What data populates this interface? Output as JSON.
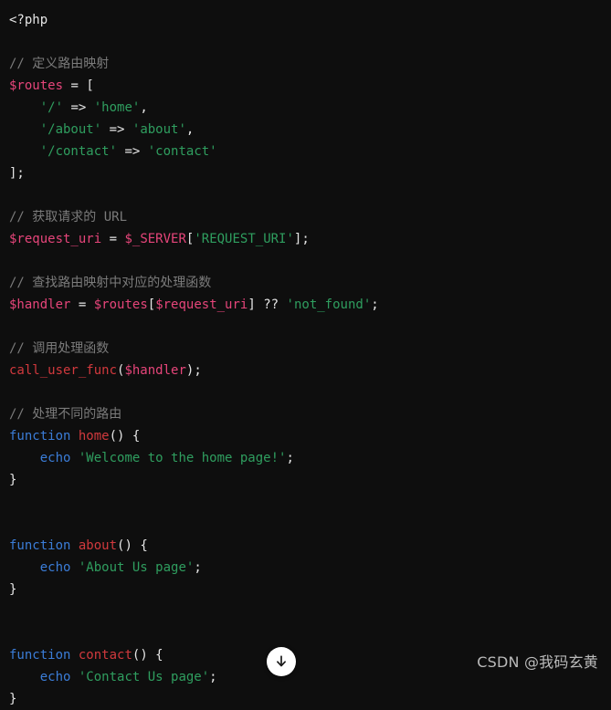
{
  "editor": {
    "language": "php",
    "background_color": "#0e0e0e",
    "font_size_px": 14,
    "line_height_px": 24
  },
  "theme": {
    "plain": "#e6e6e6",
    "comment": "#7b7b7b",
    "variable": "#e6457a",
    "string": "#2f9e5f",
    "keyword": "#3b7dd8",
    "function": "#d1393d",
    "punctuation": "#e6e6e6"
  },
  "code": {
    "lines": [
      {
        "id": "l1",
        "tokens": [
          {
            "t": "<?php",
            "c": "plain"
          }
        ]
      },
      {
        "id": "l2",
        "tokens": []
      },
      {
        "id": "l3",
        "tokens": [
          {
            "t": "// 定义路由映射",
            "c": "comment"
          }
        ]
      },
      {
        "id": "l4",
        "tokens": [
          {
            "t": "$routes",
            "c": "variable"
          },
          {
            "t": " ",
            "c": "plain"
          },
          {
            "t": "=",
            "c": "punctuation"
          },
          {
            "t": " ",
            "c": "plain"
          },
          {
            "t": "[",
            "c": "punctuation"
          }
        ]
      },
      {
        "id": "l5",
        "tokens": [
          {
            "t": "    ",
            "c": "plain"
          },
          {
            "t": "'/'",
            "c": "string"
          },
          {
            "t": " ",
            "c": "plain"
          },
          {
            "t": "=>",
            "c": "punctuation"
          },
          {
            "t": " ",
            "c": "plain"
          },
          {
            "t": "'home'",
            "c": "string"
          },
          {
            "t": ",",
            "c": "punctuation"
          }
        ]
      },
      {
        "id": "l6",
        "tokens": [
          {
            "t": "    ",
            "c": "plain"
          },
          {
            "t": "'/about'",
            "c": "string"
          },
          {
            "t": " ",
            "c": "plain"
          },
          {
            "t": "=>",
            "c": "punctuation"
          },
          {
            "t": " ",
            "c": "plain"
          },
          {
            "t": "'about'",
            "c": "string"
          },
          {
            "t": ",",
            "c": "punctuation"
          }
        ]
      },
      {
        "id": "l7",
        "tokens": [
          {
            "t": "    ",
            "c": "plain"
          },
          {
            "t": "'/contact'",
            "c": "string"
          },
          {
            "t": " ",
            "c": "plain"
          },
          {
            "t": "=>",
            "c": "punctuation"
          },
          {
            "t": " ",
            "c": "plain"
          },
          {
            "t": "'contact'",
            "c": "string"
          }
        ]
      },
      {
        "id": "l8",
        "tokens": [
          {
            "t": "];",
            "c": "punctuation"
          }
        ]
      },
      {
        "id": "l9",
        "tokens": []
      },
      {
        "id": "l10",
        "tokens": [
          {
            "t": "// 获取请求的 URL",
            "c": "comment"
          }
        ]
      },
      {
        "id": "l11",
        "tokens": [
          {
            "t": "$request_uri",
            "c": "variable"
          },
          {
            "t": " ",
            "c": "plain"
          },
          {
            "t": "=",
            "c": "punctuation"
          },
          {
            "t": " ",
            "c": "plain"
          },
          {
            "t": "$_SERVER",
            "c": "variable"
          },
          {
            "t": "[",
            "c": "punctuation"
          },
          {
            "t": "'REQUEST_URI'",
            "c": "string"
          },
          {
            "t": "];",
            "c": "punctuation"
          }
        ]
      },
      {
        "id": "l12",
        "tokens": []
      },
      {
        "id": "l13",
        "tokens": [
          {
            "t": "// 查找路由映射中对应的处理函数",
            "c": "comment"
          }
        ]
      },
      {
        "id": "l14",
        "tokens": [
          {
            "t": "$handler",
            "c": "variable"
          },
          {
            "t": " ",
            "c": "plain"
          },
          {
            "t": "=",
            "c": "punctuation"
          },
          {
            "t": " ",
            "c": "plain"
          },
          {
            "t": "$routes",
            "c": "variable"
          },
          {
            "t": "[",
            "c": "punctuation"
          },
          {
            "t": "$request_uri",
            "c": "variable"
          },
          {
            "t": "]",
            "c": "punctuation"
          },
          {
            "t": " ",
            "c": "plain"
          },
          {
            "t": "??",
            "c": "punctuation"
          },
          {
            "t": " ",
            "c": "plain"
          },
          {
            "t": "'not_found'",
            "c": "string"
          },
          {
            "t": ";",
            "c": "punctuation"
          }
        ]
      },
      {
        "id": "l15",
        "tokens": []
      },
      {
        "id": "l16",
        "tokens": [
          {
            "t": "// 调用处理函数",
            "c": "comment"
          }
        ]
      },
      {
        "id": "l17",
        "tokens": [
          {
            "t": "call_user_func",
            "c": "function"
          },
          {
            "t": "(",
            "c": "punctuation"
          },
          {
            "t": "$handler",
            "c": "variable"
          },
          {
            "t": ");",
            "c": "punctuation"
          }
        ]
      },
      {
        "id": "l18",
        "tokens": []
      },
      {
        "id": "l19",
        "tokens": [
          {
            "t": "// 处理不同的路由",
            "c": "comment"
          }
        ]
      },
      {
        "id": "l20",
        "tokens": [
          {
            "t": "function",
            "c": "keyword"
          },
          {
            "t": " ",
            "c": "plain"
          },
          {
            "t": "home",
            "c": "function"
          },
          {
            "t": "() {",
            "c": "punctuation"
          }
        ]
      },
      {
        "id": "l21",
        "tokens": [
          {
            "t": "    ",
            "c": "plain"
          },
          {
            "t": "echo",
            "c": "keyword"
          },
          {
            "t": " ",
            "c": "plain"
          },
          {
            "t": "'Welcome to the home page!'",
            "c": "string"
          },
          {
            "t": ";",
            "c": "punctuation"
          }
        ]
      },
      {
        "id": "l22",
        "tokens": [
          {
            "t": "}",
            "c": "punctuation"
          }
        ]
      },
      {
        "id": "l23",
        "tokens": []
      },
      {
        "id": "l24",
        "tokens": []
      },
      {
        "id": "l25",
        "tokens": [
          {
            "t": "function",
            "c": "keyword"
          },
          {
            "t": " ",
            "c": "plain"
          },
          {
            "t": "about",
            "c": "function"
          },
          {
            "t": "() {",
            "c": "punctuation"
          }
        ]
      },
      {
        "id": "l26",
        "tokens": [
          {
            "t": "    ",
            "c": "plain"
          },
          {
            "t": "echo",
            "c": "keyword"
          },
          {
            "t": " ",
            "c": "plain"
          },
          {
            "t": "'About Us page'",
            "c": "string"
          },
          {
            "t": ";",
            "c": "punctuation"
          }
        ]
      },
      {
        "id": "l27",
        "tokens": [
          {
            "t": "}",
            "c": "punctuation"
          }
        ]
      },
      {
        "id": "l28",
        "tokens": []
      },
      {
        "id": "l29",
        "tokens": []
      },
      {
        "id": "l30",
        "tokens": [
          {
            "t": "function",
            "c": "keyword"
          },
          {
            "t": " ",
            "c": "plain"
          },
          {
            "t": "contact",
            "c": "function"
          },
          {
            "t": "() {",
            "c": "punctuation"
          }
        ]
      },
      {
        "id": "l31",
        "tokens": [
          {
            "t": "    ",
            "c": "plain"
          },
          {
            "t": "echo",
            "c": "keyword"
          },
          {
            "t": " ",
            "c": "plain"
          },
          {
            "t": "'Contact Us page'",
            "c": "string"
          },
          {
            "t": ";",
            "c": "punctuation"
          }
        ]
      },
      {
        "id": "l32",
        "tokens": [
          {
            "t": "}",
            "c": "punctuation"
          }
        ]
      }
    ]
  },
  "controls": {
    "scroll_down": {
      "icon": "arrow-down-icon",
      "label": "",
      "background_color": "#ffffff",
      "icon_color": "#1a1a1a"
    }
  },
  "watermark": {
    "text": "CSDN @我码玄黄",
    "color": "#c9c9c9"
  }
}
